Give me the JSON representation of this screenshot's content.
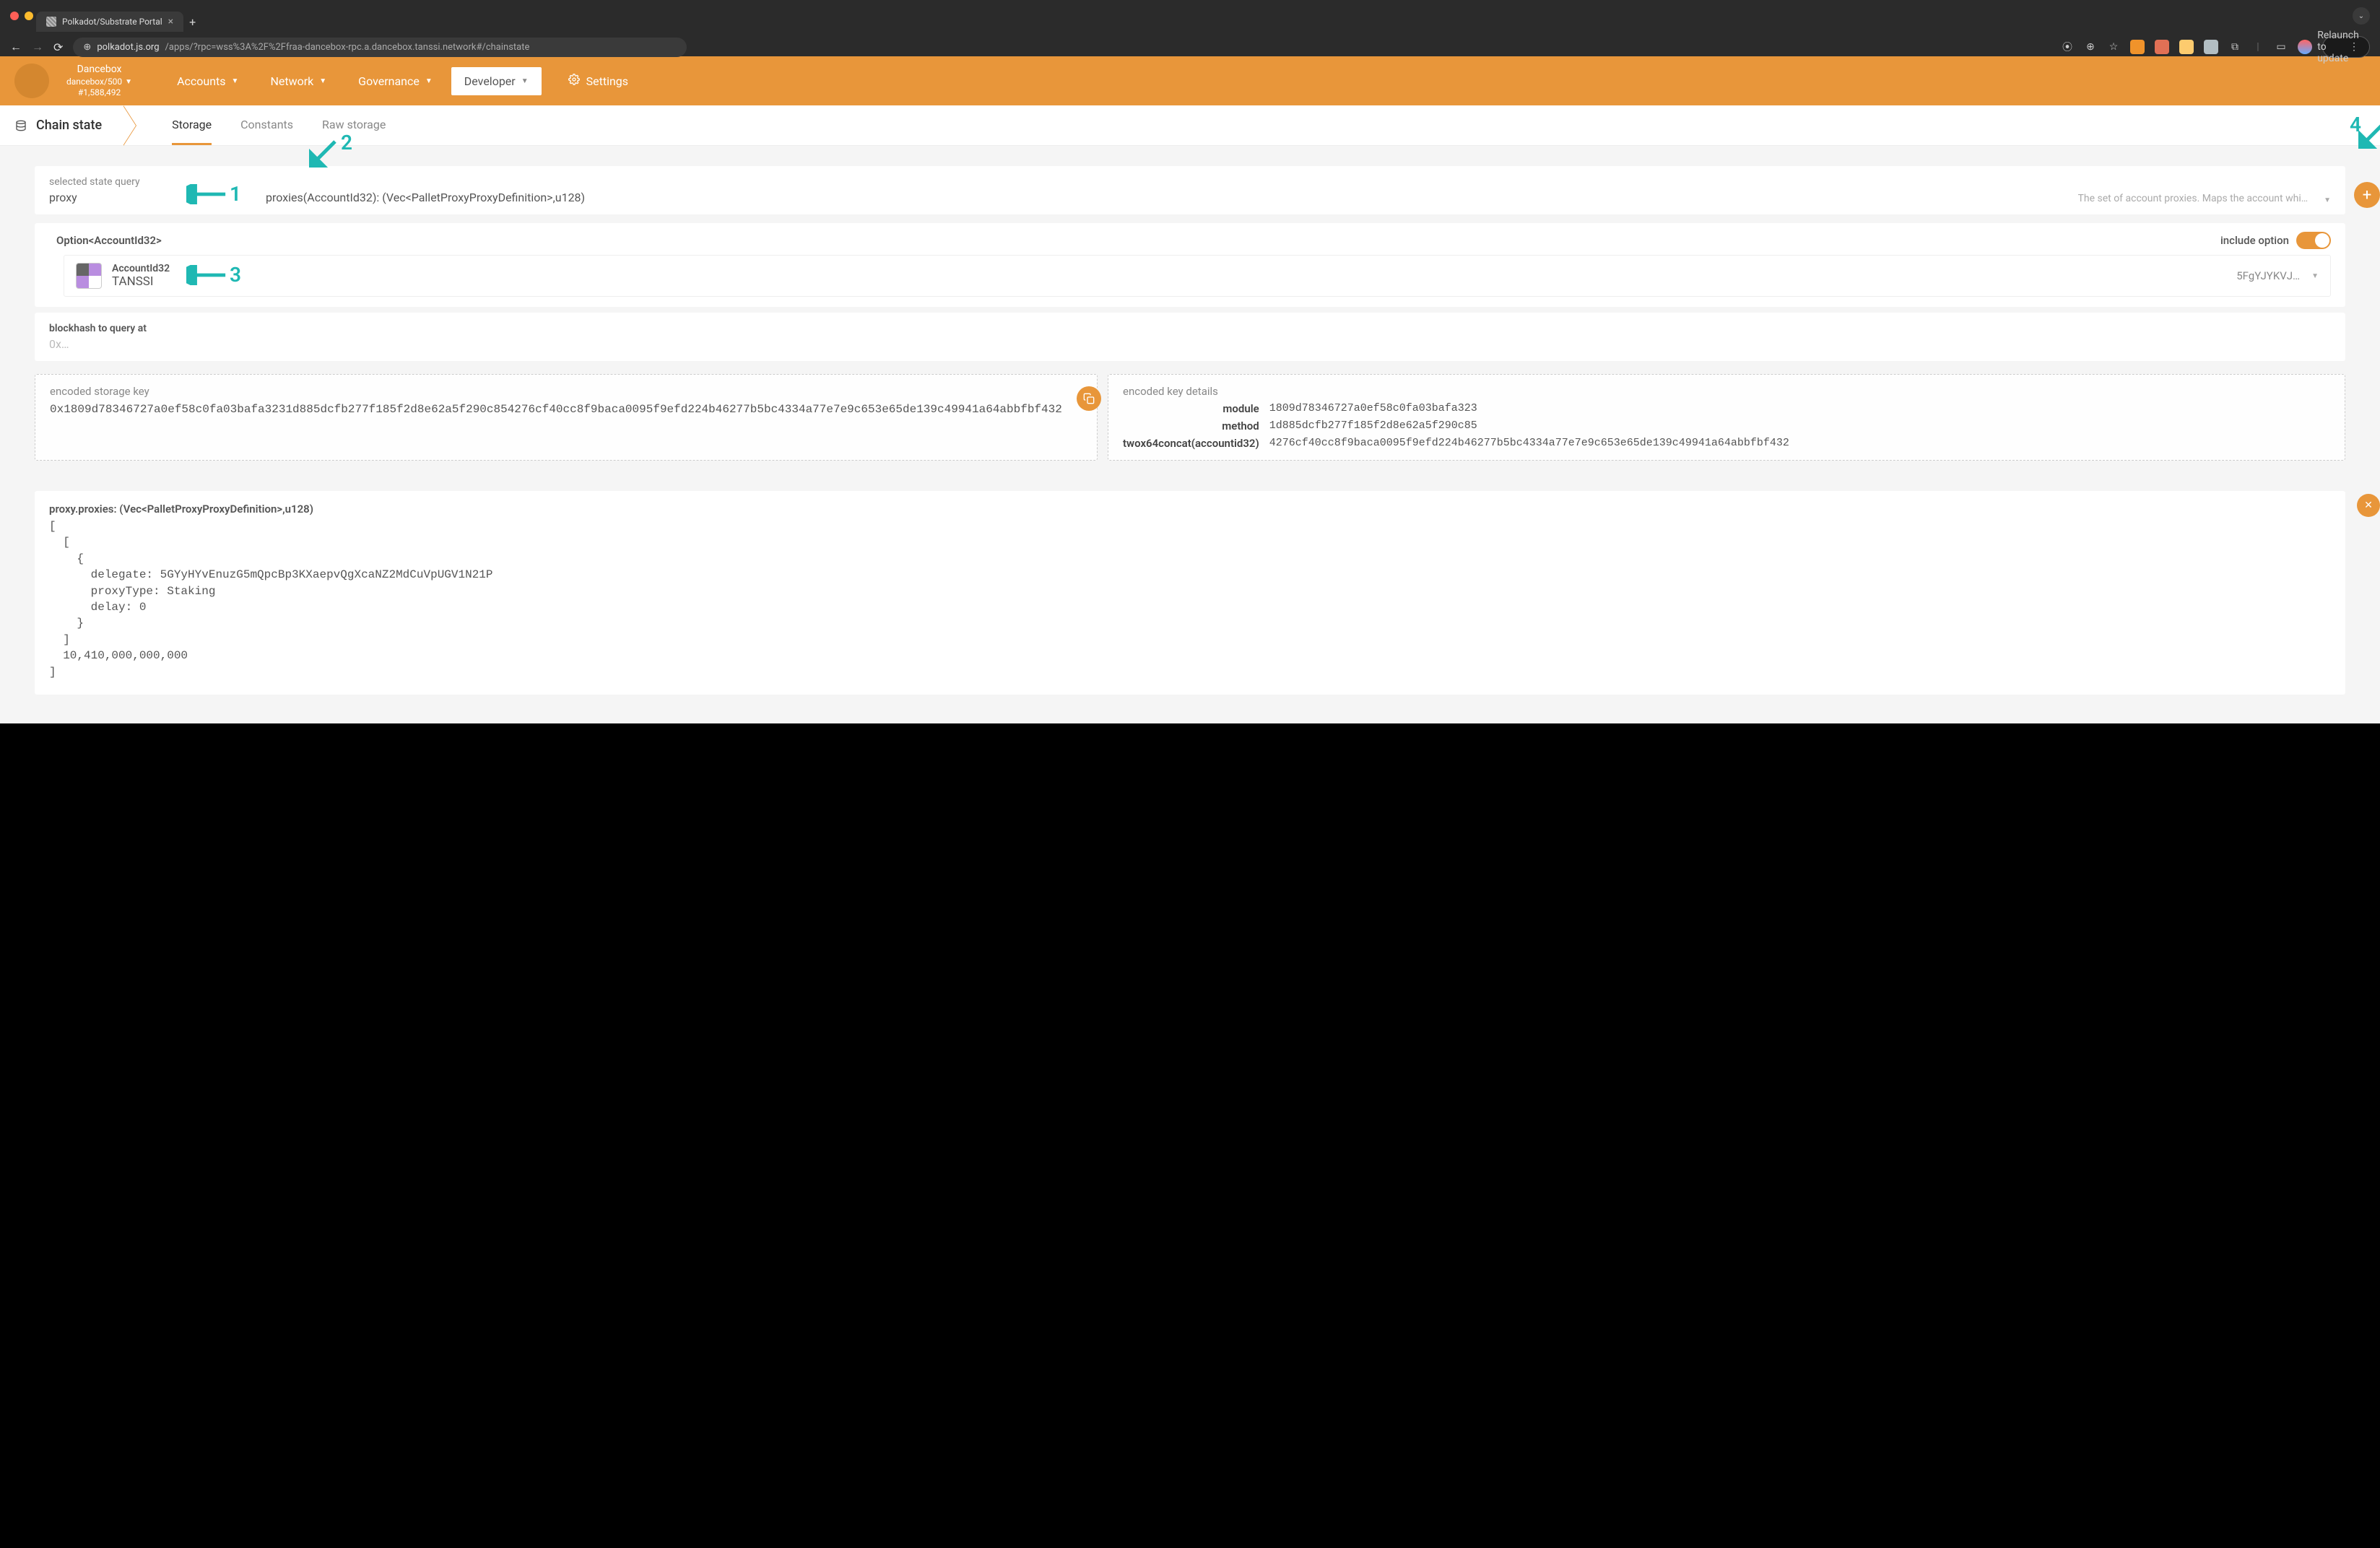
{
  "browser": {
    "tab_title": "Polkadot/Substrate Portal",
    "url_host": "polkadot.js.org",
    "url_path": "/apps/?rpc=wss%3A%2F%2Ffraa-dancebox-rpc.a.dancebox.tanssi.network#/chainstate",
    "relaunch": "Relaunch to update"
  },
  "chain": {
    "name": "Dancebox",
    "path": "dancebox/500",
    "block": "#1,588,492"
  },
  "nav": {
    "accounts": "Accounts",
    "network": "Network",
    "governance": "Governance",
    "developer": "Developer",
    "settings": "Settings"
  },
  "subnav": {
    "title": "Chain state",
    "storage": "Storage",
    "constants": "Constants",
    "raw": "Raw storage"
  },
  "query": {
    "label": "selected state query",
    "module": "proxy",
    "method": "proxies(AccountId32): (Vec<PalletProxyProxyDefinition>,u128)",
    "description": "The set of account proxies. Maps the account whi…"
  },
  "option": {
    "type_label": "Option<AccountId32>",
    "include_label": "include option",
    "account_type": "AccountId32",
    "account_name": "TANSSI",
    "account_short": "5FgYJYKVJ…"
  },
  "blockhash": {
    "label": "blockhash to query at",
    "placeholder": "0x…"
  },
  "storage_key": {
    "label": "encoded storage key",
    "value": "0x1809d78346727a0ef58c0fa03bafa3231d885dcfb277f185f2d8e62a5f290c854276cf40cc8f9baca0095f9efd224b46277b5bc4334a77e7e9c653e65de139c49941a64abbfbf432"
  },
  "key_details": {
    "label": "encoded key details",
    "module_k": "module",
    "module_v": "1809d78346727a0ef58c0fa03bafa323",
    "method_k": "method",
    "method_v": "1d885dcfb277f185f2d8e62a5f290c85",
    "twox_k": "twox64concat(accountid32)",
    "twox_v": "4276cf40cc8f9baca0095f9efd224b46277b5bc4334a77e7e9c653e65de139c49941a64abbfbf432"
  },
  "result": {
    "header": "proxy.proxies: (Vec<PalletProxyProxyDefinition>,u128)",
    "body": "[\n  [\n    {\n      delegate: 5GYyHYvEnuzG5mQpcBp3KXaepvQgXcaNZ2MdCuVpUGV1N21P\n      proxyType: Staking\n      delay: 0\n    }\n  ]\n  10,410,000,000,000\n]"
  },
  "annotations": {
    "n1": "1",
    "n2": "2",
    "n3": "3",
    "n4": "4"
  }
}
